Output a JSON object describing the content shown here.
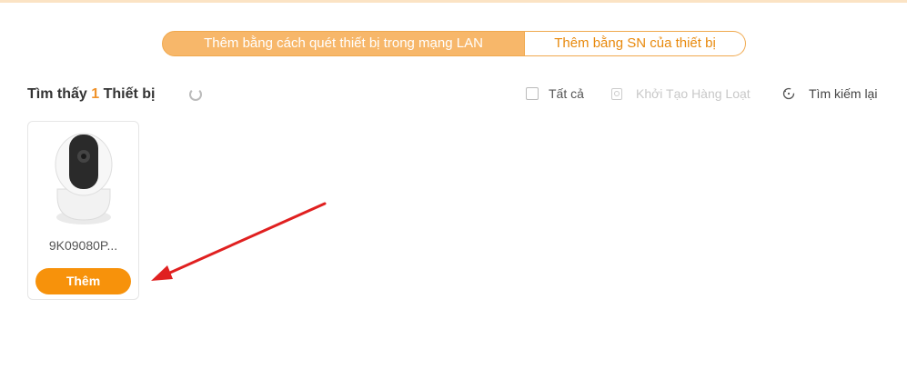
{
  "tabs": {
    "lan_scan": "Thêm bằng cách quét thiết bị trong mạng LAN",
    "by_sn": "Thêm bằng SN của thiết bị"
  },
  "header": {
    "found_prefix": "Tìm thấy ",
    "found_count": "1",
    "found_suffix": " Thiết bị",
    "select_all": "Tất cả",
    "batch_init": "Khởi Tạo Hàng Loạt",
    "rescan": "Tìm kiếm lại"
  },
  "devices": [
    {
      "sn": "9K09080P...",
      "add_label": "Thêm"
    }
  ],
  "colors": {
    "accent": "#f7920b",
    "tab_active_bg": "#f7b76a",
    "annotation_arrow": "#e02020"
  }
}
